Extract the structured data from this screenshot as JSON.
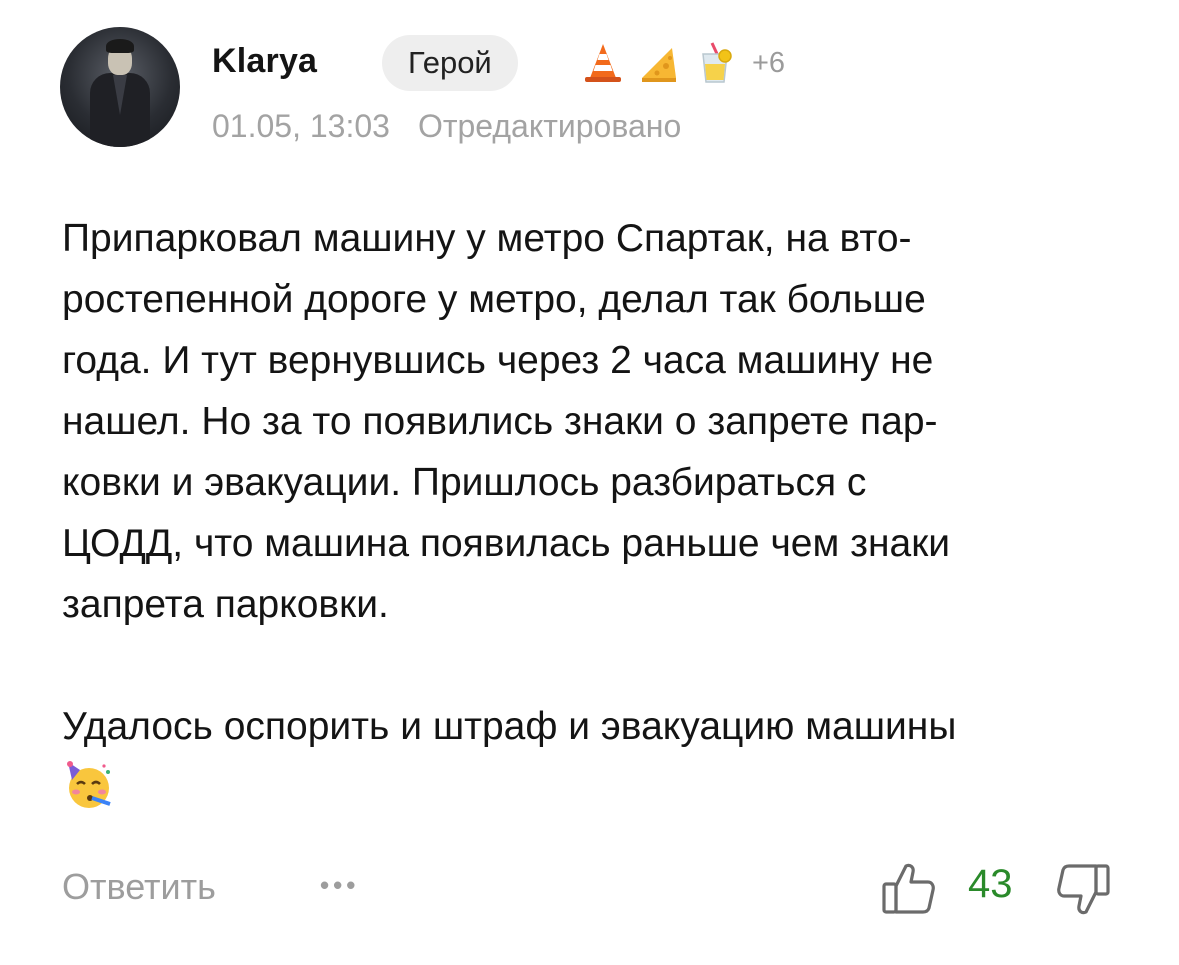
{
  "author": {
    "name": "Klarya",
    "badge": "Герой",
    "awards": [
      "traffic-cone-icon",
      "cheese-icon",
      "lemonade-icon"
    ],
    "awards_more": "+6"
  },
  "meta": {
    "timestamp": "01.05, 13:03",
    "edited_label": "Отредактировано"
  },
  "body": {
    "paragraph1": "Припарковал машину у метро Спартак, на вто-\nростепенной дороге у метро, делал так больше\nгода. И тут вернувшись через 2 часа машину не\nнашел. Но за то появились знаки о запрете пар-\nковки и эвакуации. Пришлось разбираться с\nЦОДД, что машина появилась раньше чем знаки\nзапрета парковки.",
    "paragraph2": "Удалось оспорить и штраф и эвакуацию машины",
    "emoji": "partying-face-icon"
  },
  "footer": {
    "reply_label": "Ответить",
    "more_label": "•••",
    "score": "43",
    "score_color": "#2a8a2a"
  }
}
